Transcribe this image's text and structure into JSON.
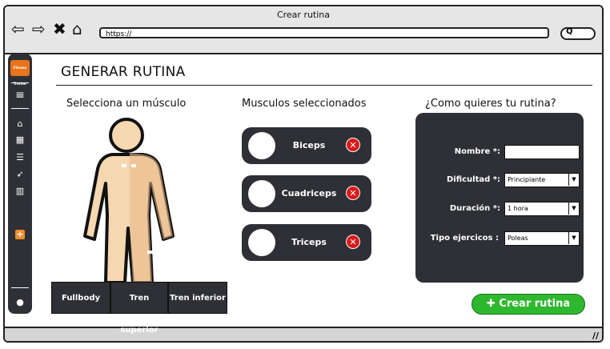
{
  "browser": {
    "title": "Crear rutina",
    "url": "https://"
  },
  "sidebar": {
    "logo_text": "Fitness Tracker"
  },
  "page": {
    "title": "GENERAR RUTINA"
  },
  "muscle_select": {
    "heading": "Selecciona un músculo",
    "tabs": [
      "Fullbody",
      "Tren superior",
      "Tren inferior"
    ]
  },
  "selected_muscles": {
    "heading": "Musculos seleccionados",
    "items": [
      "Biceps",
      "Cuadriceps",
      "Triceps"
    ]
  },
  "routine_form": {
    "heading": "¿Como quieres tu rutina?",
    "name_label": "Nombre *:",
    "name_value": "",
    "difficulty_label": "Dificultad *:",
    "difficulty_value": "Principiante",
    "duration_label": "Duración *:",
    "duration_value": "1 hora",
    "exercise_type_label": "Tipo ejercicos :",
    "exercise_type_value": "Poleas"
  },
  "actions": {
    "create_label": "Crear rutina"
  },
  "colors": {
    "panel": "#2e3035",
    "accent": "#e8741c",
    "create": "#2eb82e",
    "remove": "#d81b1b",
    "skin": "#f5d7b0"
  }
}
